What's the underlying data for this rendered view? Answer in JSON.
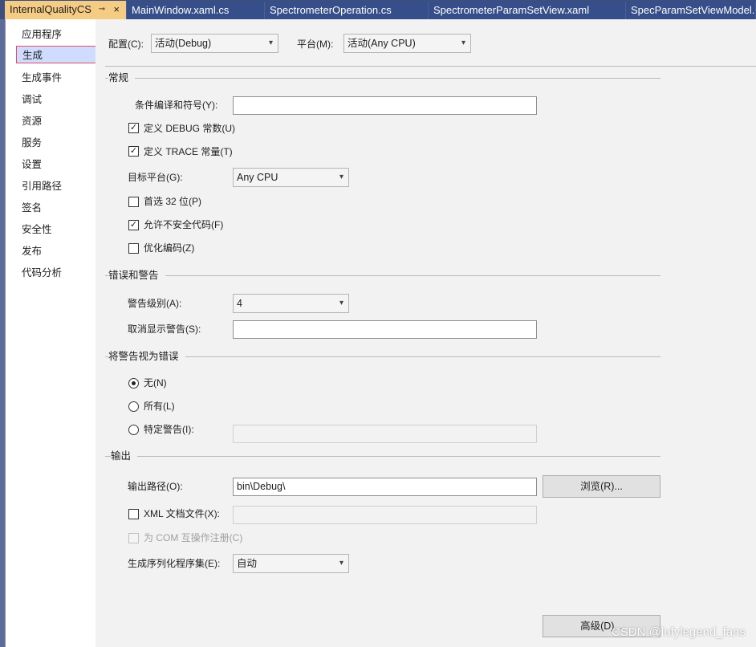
{
  "tabs": [
    {
      "label": "InternalQualityCS",
      "active": true
    },
    {
      "label": "MainWindow.xaml.cs"
    },
    {
      "label": "SpectrometerOperation.cs"
    },
    {
      "label": "SpectrometerParamSetView.xaml"
    },
    {
      "label": "SpecParamSetViewModel.cs"
    }
  ],
  "tab_icons": {
    "pin": "⊸",
    "close": "×"
  },
  "sidebar": {
    "items": [
      "应用程序",
      "生成",
      "生成事件",
      "调试",
      "资源",
      "服务",
      "设置",
      "引用路径",
      "签名",
      "安全性",
      "发布",
      "代码分析"
    ],
    "selected": "生成"
  },
  "top": {
    "config_label": "配置(C):",
    "config_value": "活动(Debug)",
    "platform_label": "平台(M):",
    "platform_value": "活动(Any CPU)"
  },
  "general": {
    "title": "常规",
    "symbols_label": "条件编译和符号(Y):",
    "symbols_value": "",
    "define_debug": "定义 DEBUG 常数(U)",
    "define_trace": "定义 TRACE 常量(T)",
    "target_label": "目标平台(G):",
    "target_value": "Any CPU",
    "prefer32": "首选 32 位(P)",
    "unsafe": "允许不安全代码(F)",
    "optimize": "优化编码(Z)",
    "check_mark": "✓"
  },
  "errors": {
    "title": "错误和警告",
    "level_label": "警告级别(A):",
    "level_value": "4",
    "suppress_label": "取消显示警告(S):",
    "suppress_value": ""
  },
  "treat": {
    "title": "将警告视为错误",
    "none": "无(N)",
    "all": "所有(L)",
    "specific": "特定警告(I):"
  },
  "output": {
    "title": "输出",
    "path_label": "输出路径(O):",
    "path_value": "bin\\Debug\\",
    "browse": "浏览(R)...",
    "xml_label": "XML 文档文件(X):",
    "com_label": "为 COM 互操作注册(C)",
    "serial_label": "生成序列化程序集(E):",
    "serial_value": "自动",
    "advanced": "高级(D)..."
  },
  "watermark": "CSDN @lufylegend_fans"
}
